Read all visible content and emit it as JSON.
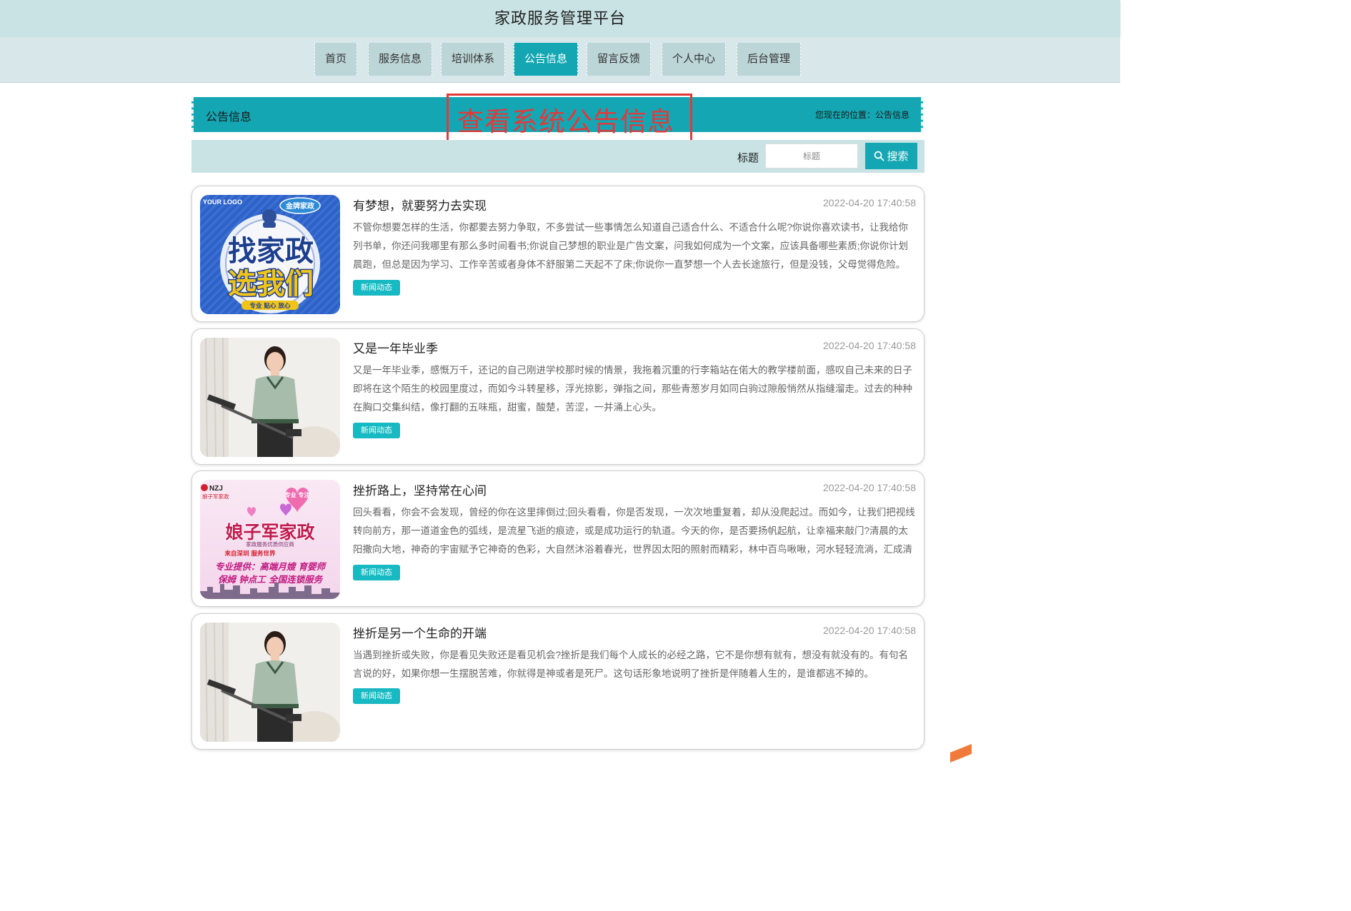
{
  "site_title": "家政服务管理平台",
  "nav": [
    "首页",
    "服务信息",
    "培训体系",
    "公告信息",
    "留言反馈",
    "个人中心",
    "后台管理"
  ],
  "section": {
    "title": "公告信息",
    "breadcrumb": "您现在的位置：公告信息"
  },
  "annotation": "查看系统公告信息",
  "search": {
    "label": "标题",
    "placeholder": "标题",
    "value": "",
    "button_label": "搜索"
  },
  "notices": [
    {
      "title": "有梦想，就要努力去实现",
      "date": "2022-04-20 17:40:58",
      "body": "不管你想要怎样的生活，你都要去努力争取，不多尝试一些事情怎么知道自己适合什么、不适合什么呢?你说你喜欢读书，让我给你列书单，你还问我哪里有那么多时间看书;你说自己梦想的职业是广告文案，问我如何成为一个文案，应该具备哪些素质;你说你计划晨跑，但总是因为学习、工作辛苦或者身体不舒服第二天起不了床;你说你一直梦想一个人去长途旅行，但是没钱，父母觉得危险。",
      "tag": "新闻动态",
      "image": {
        "kind": "ad-banner",
        "logo_text": "YOUR LOGO",
        "badge_text": "金牌家政",
        "line1": "找家政",
        "line2": "选我们",
        "footer": "专业  贴心  放心"
      }
    },
    {
      "title": "又是一年毕业季",
      "date": "2022-04-20 17:40:58",
      "body": "又是一年毕业季，感慨万千，还记的自己刚进学校那时候的情景，我拖着沉重的行李箱站在偌大的教学楼前面，感叹自己未来的日子即将在这个陌生的校园里度过，而如今斗转星移，浮光掠影，弹指之间，那些青葱岁月如同白驹过隙般悄然从指缝溜走。过去的种种在胸口交集纠结，像打翻的五味瓶，甜蜜，酸楚，苦涩，一并涌上心头。",
      "tag": "新闻动态",
      "image": {
        "kind": "cleaner-photo"
      }
    },
    {
      "title": "挫折路上，坚持常在心间",
      "date": "2022-04-20 17:40:58",
      "body": "回头看看，你会不会发现，曾经的你在这里摔倒过;回头看看，你是否发现，一次次地重复着，却从没爬起过。而如今，让我们把视线转向前方，那一道道金色的弧线，是流星飞逝的痕迹，或是成功运行的轨道。今天的你，是否要扬帆起航，让幸福来敲门?清晨的太阳撒向大地，神奇的宇宙赋予它神奇的色彩，大自然沐浴着春光，世界因太阳的照射而精彩，林中百鸟啾啾，河水轻轻流淌，汇成清宁的山间小溪……",
      "tag": "新闻动态",
      "image": {
        "kind": "agency-poster",
        "brand": "NZJ",
        "brand_sub": "娘子军家政",
        "heart_text": "专业 专注",
        "headline": "娘子军家政",
        "sub": "家政服务优质供应商",
        "tagline": "来自深圳  服务世界",
        "line1": "专业提供：高端月嫂  育婴师",
        "line2": "保姆  钟点工  全国连锁服务"
      }
    },
    {
      "title": "挫折是另一个生命的开端",
      "date": "2022-04-20 17:40:58",
      "body": "当遇到挫折或失败，你是看见失败还是看见机会?挫折是我们每个人成长的必经之路，它不是你想有就有，想没有就没有的。有句名言说的好，如果你想一生摆脱苦难，你就得是神或者是死尸。这句话形象地说明了挫折是伴随着人生的，是谁都逃不掉的。",
      "tag": "新闻动态",
      "image": {
        "kind": "cleaner-photo"
      }
    }
  ],
  "colors": {
    "primary": "#14a7b3",
    "header_bg": "#c9e3e4",
    "nav_bg": "#d8e7ea",
    "annotation": "#e03a3a",
    "tag": "#17b9c3"
  }
}
